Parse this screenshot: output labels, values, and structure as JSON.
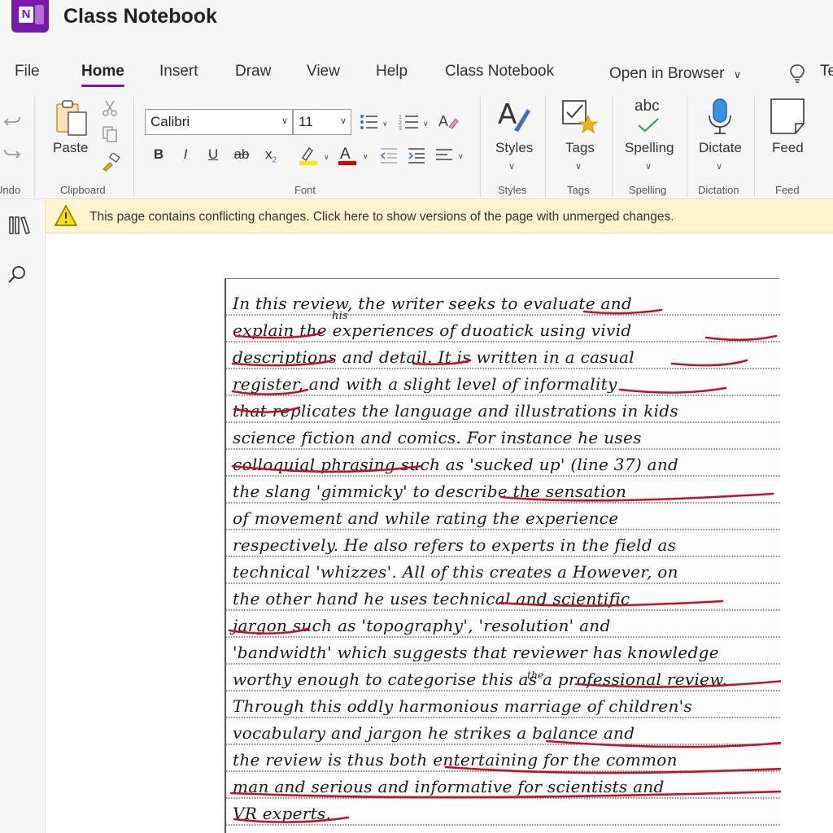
{
  "app": {
    "title": "Class Notebook",
    "icon": "onenote-icon"
  },
  "tabs": [
    {
      "label": "File",
      "active": false
    },
    {
      "label": "Home",
      "active": true
    },
    {
      "label": "Insert",
      "active": false
    },
    {
      "label": "Draw",
      "active": false
    },
    {
      "label": "View",
      "active": false
    },
    {
      "label": "Help",
      "active": false
    },
    {
      "label": "Class Notebook",
      "active": false
    }
  ],
  "open_in_browser": {
    "label": "Open in Browser"
  },
  "tell_me_partial": "Te",
  "ribbon": {
    "undo_group": "Undo",
    "clipboard": {
      "paste_label": "Paste",
      "group": "Clipboard"
    },
    "font": {
      "family": "Calibri",
      "size": "11",
      "group": "Font",
      "bold": "B",
      "italic": "I",
      "underline": "U",
      "strike": "ab",
      "subscript": "x",
      "subscript_small": "2"
    },
    "styles": {
      "label": "Styles",
      "group": "Styles"
    },
    "tags": {
      "label": "Tags",
      "group": "Tags"
    },
    "spelling": {
      "label": "Spelling",
      "group": "Spelling",
      "abc": "abc"
    },
    "dictation": {
      "label": "Dictate",
      "group": "Dictation"
    },
    "feed": {
      "label": "Feed",
      "group": "Feed"
    }
  },
  "infobar": {
    "message": "This page contains conflicting changes. Click here to show versions of the page with unmerged changes."
  },
  "colors": {
    "accent": "#7719aa",
    "highlight": "#ffff00",
    "font_color": "#e00000",
    "red_ink": "#c4102c",
    "infobar_bg": "#fff4ce"
  },
  "handwriting": [
    "In this review, the writer seeks to evaluate and",
    "explain the experiences of duoatick using vivid",
    "descriptions and detail. It is written in a casual",
    "register, and with a slight level of informality",
    "that replicates the language and illustrations in kids",
    "science fiction and comics. For instance he uses",
    "colloquial phrasing such as 'sucked up' (line 37) and",
    "the slang 'gimmicky' to describe the sensation",
    "of movement and while rating the experience",
    "respectively. He also refers to experts in the field as",
    "technical 'whizzes'. All of this creates a However, on",
    "the other hand he uses technical and scientific",
    "jargon such as 'topography', 'resolution' and",
    "'bandwidth' which suggests that reviewer has knowledge",
    "worthy enough to categorise this as a professional review.",
    "Through this oddly harmonious marriage of children's",
    "vocabulary and jargon he strikes a balance and",
    "the review is thus both entertaining for the common",
    "man and serious and informative for scientists and",
    "VR experts."
  ],
  "handwriting_insertions": {
    "his": "his",
    "the": "the"
  }
}
